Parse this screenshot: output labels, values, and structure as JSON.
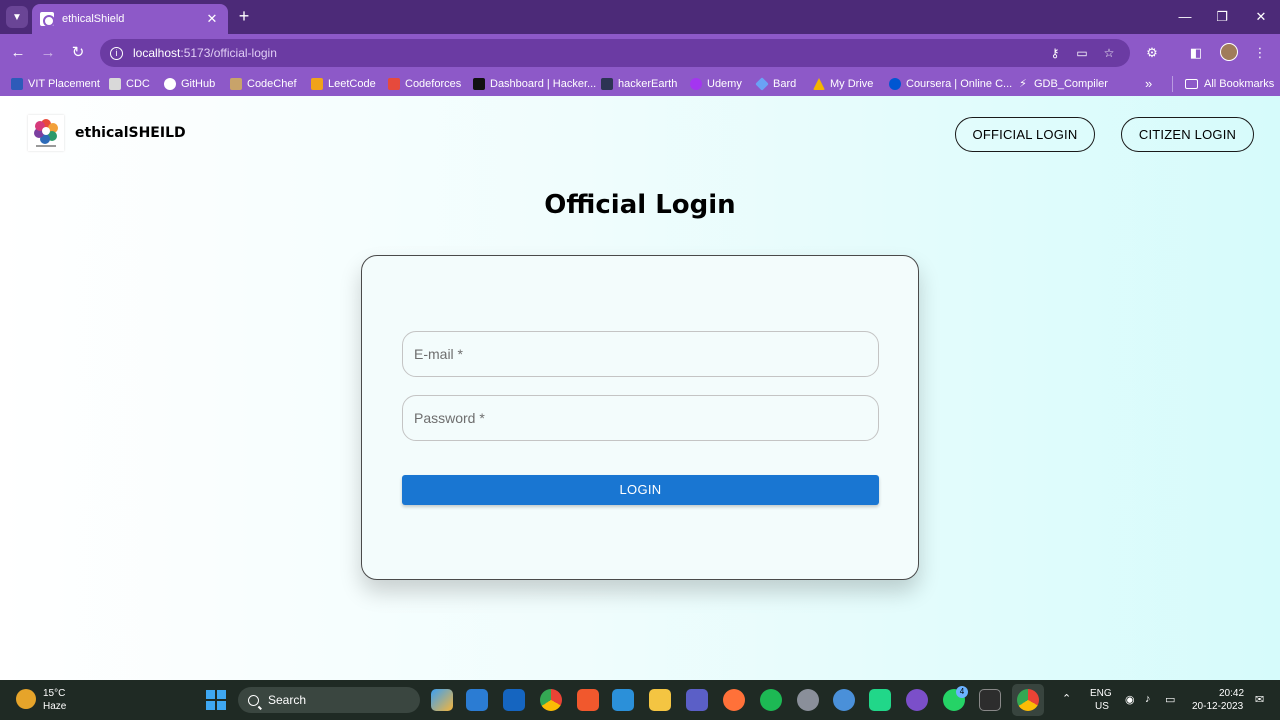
{
  "browser": {
    "tab_title": "ethicalShield",
    "url_host": "localhost",
    "url_path": ":5173/official-login",
    "bookmarks": [
      {
        "label": "VIT Placement",
        "color": "#2d5bb9"
      },
      {
        "label": "CDC",
        "color": "#d9d9d9"
      },
      {
        "label": "GitHub",
        "color": "#ffffff"
      },
      {
        "label": "CodeChef",
        "color": "#c8a36a"
      },
      {
        "label": "LeetCode",
        "color": "#f0a31a"
      },
      {
        "label": "Codeforces",
        "color": "#e64a3c"
      },
      {
        "label": "Dashboard | Hacker...",
        "color": "#111111"
      },
      {
        "label": "hackerEarth",
        "color": "#2c3454"
      },
      {
        "label": "Udemy",
        "color": "#a435f0"
      },
      {
        "label": "Bard",
        "color": "#6aa2f5"
      },
      {
        "label": "My Drive",
        "color": "#f4b400"
      },
      {
        "label": "Coursera | Online C...",
        "color": "#0056d2"
      },
      {
        "label": "GDB_Compiler",
        "color": "#222222"
      }
    ],
    "all_bookmarks_label": "All Bookmarks"
  },
  "header": {
    "brand": "ethicalSHEILD",
    "official_login_label": "OFFICIAL LOGIN",
    "citizen_login_label": "CITIZEN LOGIN"
  },
  "login": {
    "title": "Official Login",
    "email_placeholder": "E-mail *",
    "password_placeholder": "Password *",
    "submit_label": "LOGIN",
    "accent_color": "#1976d2"
  },
  "taskbar": {
    "weather_temp": "15°C",
    "weather_desc": "Haze",
    "search_label": "Search",
    "lang_line1": "ENG",
    "lang_line2": "US",
    "time": "20:42",
    "date": "20-12-2023",
    "whatsapp_badge": "4"
  }
}
